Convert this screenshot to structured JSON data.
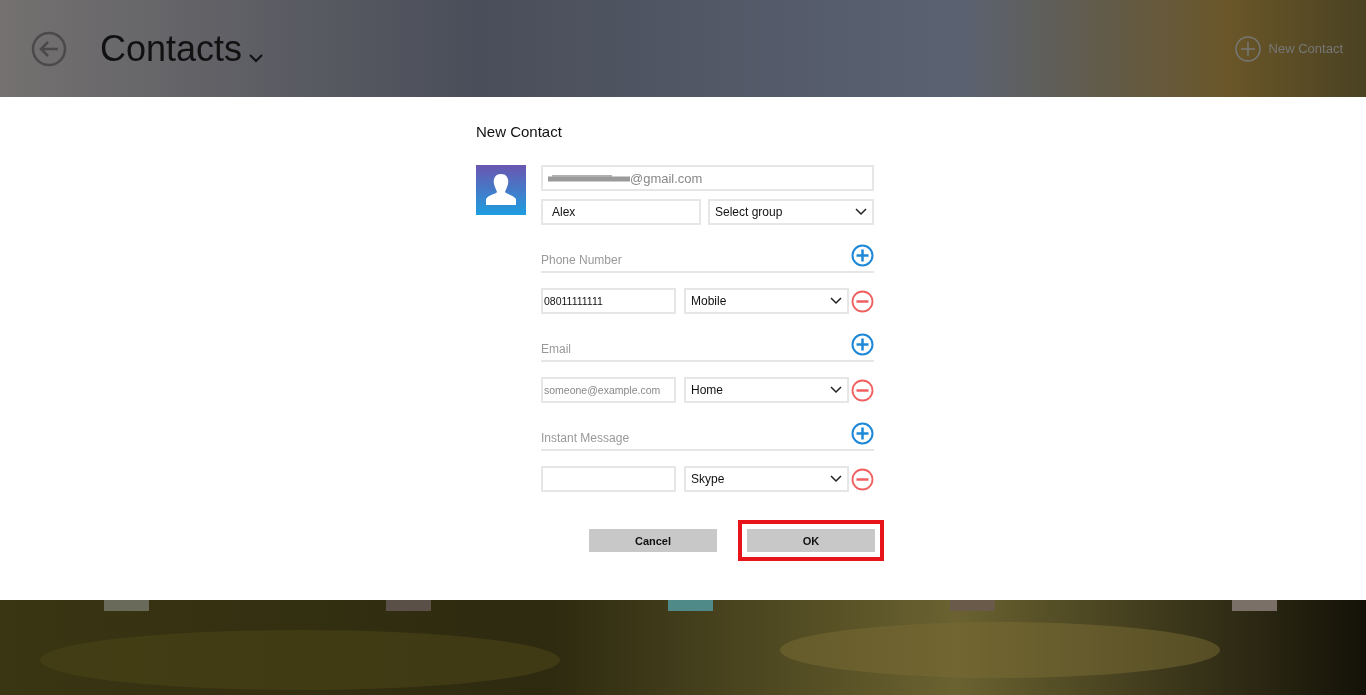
{
  "header": {
    "title": "Contacts",
    "new_contact": "New Contact"
  },
  "dialog": {
    "title": "New Contact",
    "account_email": {
      "value": "@gmail.com"
    },
    "name": {
      "value": "Alex"
    },
    "group": {
      "value": "Select group"
    },
    "sections": [
      {
        "label": "Phone Number",
        "entries": [
          {
            "value": "08011111111",
            "type": "Mobile"
          }
        ]
      },
      {
        "label": "Email",
        "entries": [
          {
            "placeholder": "someone@example.com",
            "type": "Home"
          }
        ]
      },
      {
        "label": "Instant Message",
        "entries": [
          {
            "type": "Skype"
          }
        ]
      }
    ],
    "buttons": [
      {
        "label": "Cancel",
        "highlighted": false
      },
      {
        "label": "OK",
        "highlighted": true
      }
    ]
  }
}
